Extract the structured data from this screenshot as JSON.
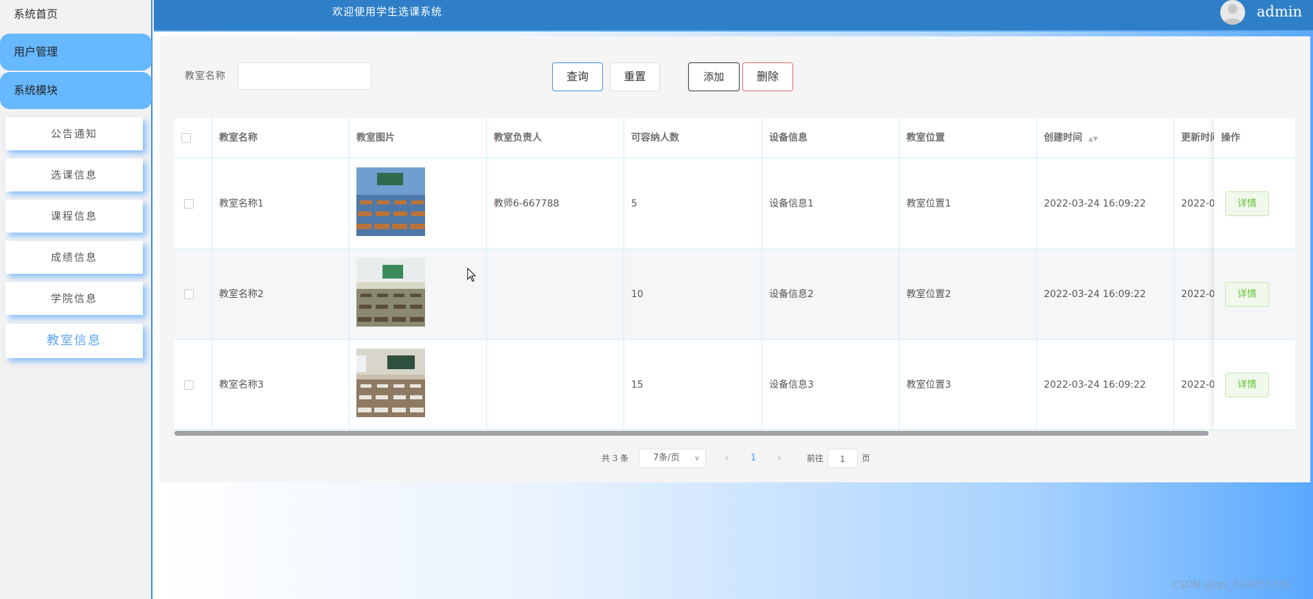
{
  "sidebar": {
    "home": "系统首页",
    "groups": [
      "用户管理",
      "系统模块"
    ],
    "items": [
      {
        "label": "公告通知"
      },
      {
        "label": "选课信息"
      },
      {
        "label": "课程信息"
      },
      {
        "label": "成绩信息"
      },
      {
        "label": "学院信息"
      },
      {
        "label": "教室信息",
        "active": true
      }
    ]
  },
  "header": {
    "welcome": "欢迎使用学生选课系统",
    "username": "admin"
  },
  "search": {
    "label": "教室名称",
    "value": "",
    "query_button": "查询",
    "reset_button": "重置",
    "add_button": "添加",
    "delete_button": "删除"
  },
  "table": {
    "columns": [
      "教室名称",
      "教室图片",
      "教室负责人",
      "可容纳人数",
      "设备信息",
      "教室位置",
      "创建时间",
      "更新时间",
      "操作"
    ],
    "rows": [
      {
        "name": "教室名称1",
        "manager": "教师6-667788",
        "capacity": "5",
        "equipment": "设备信息1",
        "location": "教室位置1",
        "created": "2022-03-24 16:09:22",
        "updated": "2022-0",
        "action": "详情"
      },
      {
        "name": "教室名称2",
        "manager": "",
        "capacity": "10",
        "equipment": "设备信息2",
        "location": "教室位置2",
        "created": "2022-03-24 16:09:22",
        "updated": "2022-0",
        "action": "详情"
      },
      {
        "name": "教室名称3",
        "manager": "",
        "capacity": "15",
        "equipment": "设备信息3",
        "location": "教室位置3",
        "created": "2022-03-24 16:09:22",
        "updated": "2022-0",
        "action": "详情"
      }
    ]
  },
  "pagination": {
    "total": "共 3 条",
    "page_size": "7条/页",
    "current_page": "1",
    "goto_label": "前往",
    "goto_value": "1",
    "page_unit": "页"
  },
  "watermark": "CSDN @qq_834251331",
  "colors": {
    "header": "#2f7fc8",
    "sidebar_group": "#66b8ff",
    "accent": "#409eff",
    "detail_button": "#67c23a"
  }
}
